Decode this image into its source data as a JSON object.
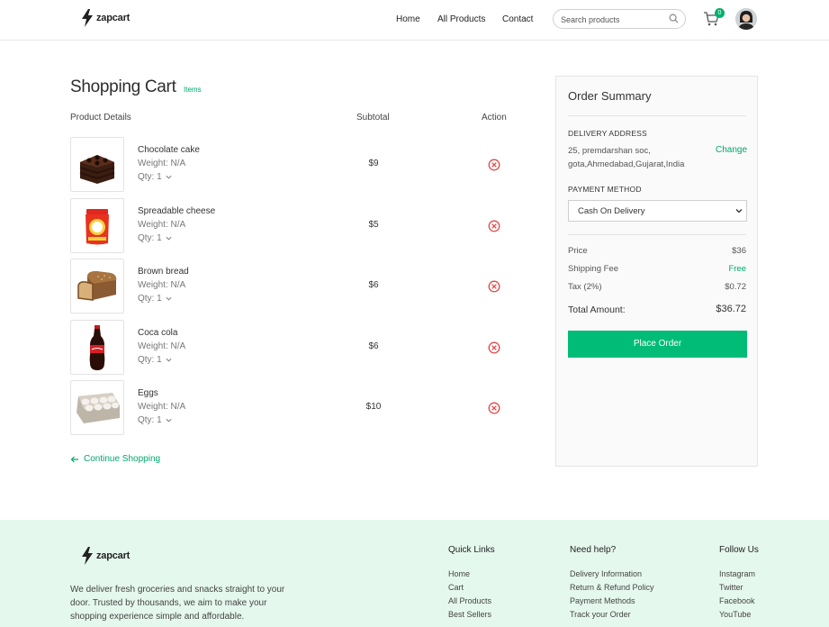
{
  "header": {
    "logo_text": "zapcart",
    "nav": [
      "Home",
      "All Products",
      "Contact"
    ],
    "search_placeholder": "Search products",
    "cart_count": "0"
  },
  "cart": {
    "title": "Shopping Cart",
    "items_label": "Items",
    "columns": {
      "product": "Product Details",
      "subtotal": "Subtotal",
      "action": "Action"
    },
    "items": [
      {
        "name": "Chocolate cake",
        "weight": "Weight: N/A",
        "qty": "Qty: 1",
        "subtotal": "$9",
        "image_icon": "chocolate-cake-image"
      },
      {
        "name": "Spreadable cheese",
        "weight": "Weight: N/A",
        "qty": "Qty: 1",
        "subtotal": "$5",
        "image_icon": "cheese-jar-image"
      },
      {
        "name": "Brown bread",
        "weight": "Weight: N/A",
        "qty": "Qty: 1",
        "subtotal": "$6",
        "image_icon": "brown-bread-image"
      },
      {
        "name": "Coca cola",
        "weight": "Weight: N/A",
        "qty": "Qty: 1",
        "subtotal": "$6",
        "image_icon": "cola-bottle-image"
      },
      {
        "name": "Eggs",
        "weight": "Weight: N/A",
        "qty": "Qty: 1",
        "subtotal": "$10",
        "image_icon": "egg-carton-image"
      }
    ],
    "continue_label": "Continue Shopping"
  },
  "summary": {
    "title": "Order Summary",
    "delivery_label": "DELIVERY ADDRESS",
    "address": "25, premdarshan soc, gota,Ahmedabad,Gujarat,India",
    "change_label": "Change",
    "payment_label": "PAYMENT METHOD",
    "payment_selected": "Cash On Delivery",
    "price_label": "Price",
    "price_value": "$36",
    "shipping_label": "Shipping Fee",
    "shipping_value": "Free",
    "tax_label": "Tax (2%)",
    "tax_value": "$0.72",
    "total_label": "Total Amount:",
    "total_value": "$36.72",
    "place_order_label": "Place Order"
  },
  "footer": {
    "logo_text": "zapcart",
    "description": "We deliver fresh groceries and snacks straight to your door. Trusted by thousands, we aim to make your shopping experience simple and affordable.",
    "quick_links_title": "Quick Links",
    "quick_links": [
      "Home",
      "Cart",
      "All Products",
      "Best Sellers"
    ],
    "help_title": "Need help?",
    "help_links": [
      "Delivery Information",
      "Return & Refund Policy",
      "Payment Methods",
      "Track your Order"
    ],
    "follow_title": "Follow Us",
    "follow_links": [
      "Instagram",
      "Twitter",
      "Facebook",
      "YouTube"
    ]
  },
  "colors": {
    "accent": "#00b16a",
    "remove": "#e54848",
    "footer_bg": "#e5f8ee"
  }
}
